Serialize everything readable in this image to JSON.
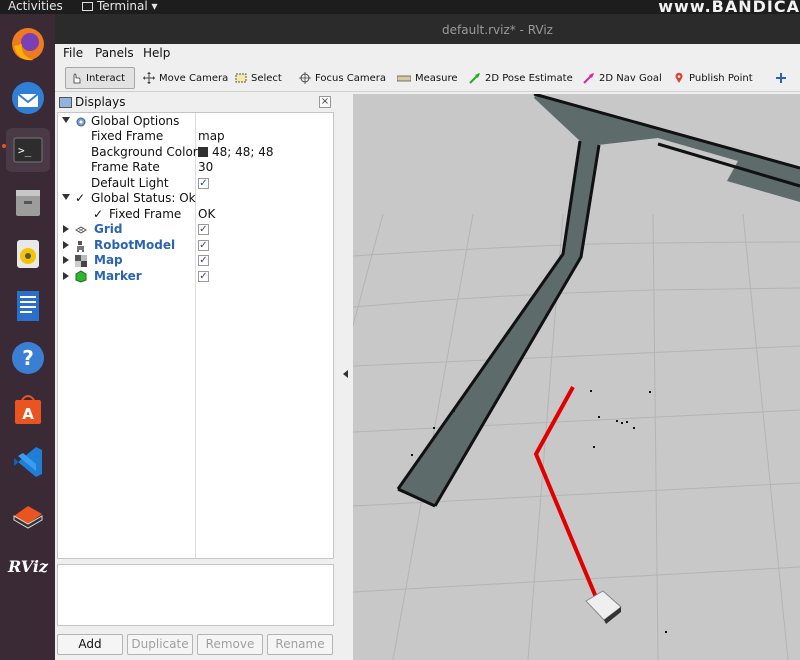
{
  "topbar": {
    "activities": "Activities",
    "terminal": "Terminal ▾",
    "watermark": "www.BANDICA"
  },
  "window": {
    "title": "default.rviz* - RViz"
  },
  "menus": [
    "File",
    "Panels",
    "Help"
  ],
  "toolbar": [
    {
      "label": "Interact",
      "icon": "hand-pointer-icon"
    },
    {
      "label": "Move Camera",
      "icon": "move-arrows-icon"
    },
    {
      "label": "Select",
      "icon": "select-box-icon"
    },
    {
      "label": "Focus Camera",
      "icon": "target-icon"
    },
    {
      "label": "Measure",
      "icon": "ruler-icon"
    },
    {
      "label": "2D Pose Estimate",
      "icon": "green-arrow-icon"
    },
    {
      "label": "2D Nav Goal",
      "icon": "pink-arrow-icon"
    },
    {
      "label": "Publish Point",
      "icon": "map-pin-icon"
    }
  ],
  "displays": {
    "title": "Displays",
    "global_options": "Global Options",
    "fixed_frame_label": "Fixed Frame",
    "fixed_frame_value": "map",
    "background_color_label": "Background Color",
    "background_color_value": "48; 48; 48",
    "frame_rate_label": "Frame Rate",
    "frame_rate_value": "30",
    "default_light_label": "Default Light",
    "global_status": "Global Status: Ok",
    "status_fixed_frame_label": "Fixed Frame",
    "status_fixed_frame_value": "OK",
    "items": [
      "Grid",
      "RobotModel",
      "Map",
      "Marker"
    ]
  },
  "buttons": {
    "add": "Add",
    "duplicate": "Duplicate",
    "remove": "Remove",
    "rename": "Rename"
  },
  "colors": {
    "path": "#e00000",
    "map_free": "#5d6b6b",
    "viewport_bg": "#c8c8c8",
    "accent": "#2b63b3"
  }
}
